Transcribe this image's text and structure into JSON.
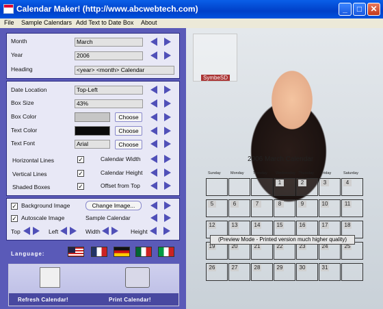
{
  "window": {
    "title": "Calendar Maker! (http://www.abcwebtech.com)",
    "minimize": "_",
    "maximize": "□",
    "close": "✕"
  },
  "menu": [
    "File",
    "Sample Calendars",
    "Add Text to Date Box",
    "About"
  ],
  "panel1": {
    "month_label": "Month",
    "month_value": "March",
    "year_label": "Year",
    "year_value": "2006",
    "heading_label": "Heading",
    "heading_value": "<year> <month> Calendar"
  },
  "panel2": {
    "date_location_label": "Date Location",
    "date_location_value": "Top-Left",
    "box_size_label": "Box Size",
    "box_size_value": "43%",
    "box_color_label": "Box Color",
    "box_color": "#c6c6c6",
    "text_color_label": "Text Color",
    "text_color": "#0a0a0a",
    "text_font_label": "Text Font",
    "text_font_value": "Arial",
    "choose": "Choose",
    "horizontal_lines": "Horizontal Lines",
    "vertical_lines": "Vertical Lines",
    "shaded_boxes": "Shaded Boxes",
    "calendar_width": "Calendar Width",
    "calendar_height": "Calendar Height",
    "offset_from_top": "Offset from Top",
    "check": "✓"
  },
  "panel3": {
    "background_image": "Background Image",
    "change_image": "Change Image...",
    "autoscale_image": "Autoscale Image",
    "sample_calendar": "Sample Calendar",
    "top": "Top",
    "left": "Left",
    "width": "Width",
    "height": "Height"
  },
  "language": {
    "label": "Language:",
    "flags": [
      "us-flag-icon",
      "france-flag-icon",
      "germany-flag-icon",
      "mexico-flag-icon",
      "italy-flag-icon"
    ]
  },
  "buttons": {
    "refresh": "Refresh Calendar!",
    "print": "Print Calendar!"
  },
  "preview": {
    "logo_text": "SymbeSD",
    "calendar_title": "2006 March Calendar",
    "day_headers": [
      "Sunday",
      "Monday",
      "Tuesday",
      "Wednesday",
      "Thursday",
      "Friday",
      "Saturday"
    ],
    "weeks": [
      [
        "",
        "",
        "",
        "1",
        "2",
        "3",
        "4"
      ],
      [
        "5",
        "6",
        "7",
        "8",
        "9",
        "10",
        "11"
      ],
      [
        "12",
        "13",
        "14",
        "15",
        "16",
        "17",
        "18"
      ],
      [
        "19",
        "20",
        "21",
        "22",
        "23",
        "24",
        "25"
      ],
      [
        "26",
        "27",
        "28",
        "29",
        "30",
        "31",
        ""
      ]
    ],
    "notice": "(Preview Mode - Printed version much higher quality)"
  }
}
